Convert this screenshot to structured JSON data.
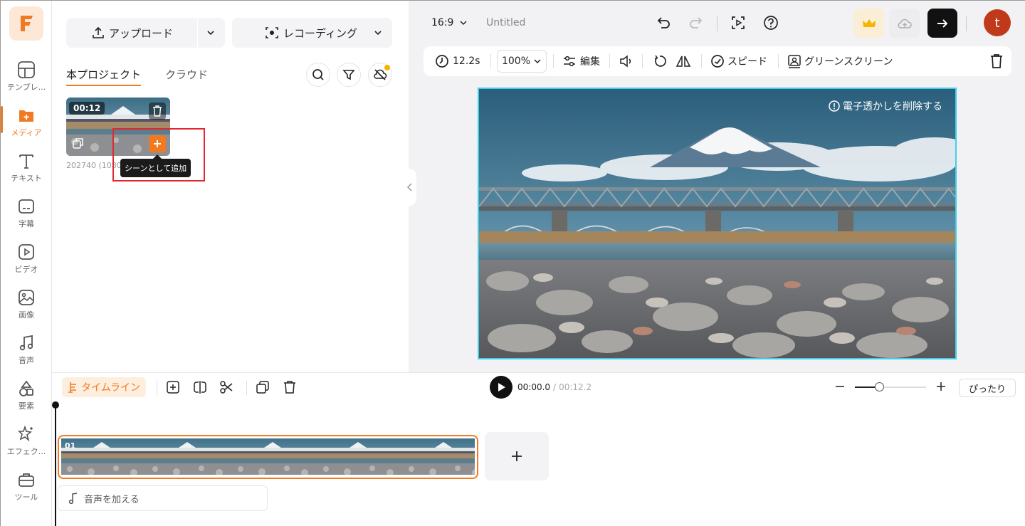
{
  "sidebar": {
    "items": [
      {
        "label": "テンプレ...",
        "icon": "template-icon"
      },
      {
        "label": "メディア",
        "icon": "media-icon",
        "active": true
      },
      {
        "label": "テキスト",
        "icon": "text-icon"
      },
      {
        "label": "字幕",
        "icon": "subtitle-icon"
      },
      {
        "label": "ビデオ",
        "icon": "video-icon"
      },
      {
        "label": "画像",
        "icon": "image-icon"
      },
      {
        "label": "音声",
        "icon": "music-icon"
      },
      {
        "label": "要素",
        "icon": "elements-icon"
      },
      {
        "label": "エフェク...",
        "icon": "effects-icon"
      },
      {
        "label": "ツール",
        "icon": "tools-icon"
      }
    ]
  },
  "media": {
    "upload_label": "アップロード",
    "record_label": "レコーディング",
    "tabs": [
      "本プロジェクト",
      "クラウド"
    ],
    "thumb_duration": "00:12",
    "thumb_caption": "202740 (1080",
    "tooltip": "シーンとして追加"
  },
  "header": {
    "ratio": "16:9",
    "title": "Untitled"
  },
  "toolbar": {
    "duration": "12.2s",
    "zoom": "100%",
    "edit": "編集",
    "speed": "スピード",
    "greenscreen": "グリーンスクリーン"
  },
  "preview": {
    "watermark": "電子透かしを削除する"
  },
  "user": {
    "initial": "t"
  },
  "timeline": {
    "label": "タイムライン",
    "current": "00:00.0",
    "separator": "/",
    "total": "00:12.2",
    "fit": "ぴったり",
    "clip_index": "01",
    "add_audio": "音声を加える"
  },
  "colors": {
    "accent": "#f07a22",
    "highlight": "#e3272f",
    "frame": "#3fd0e8"
  }
}
